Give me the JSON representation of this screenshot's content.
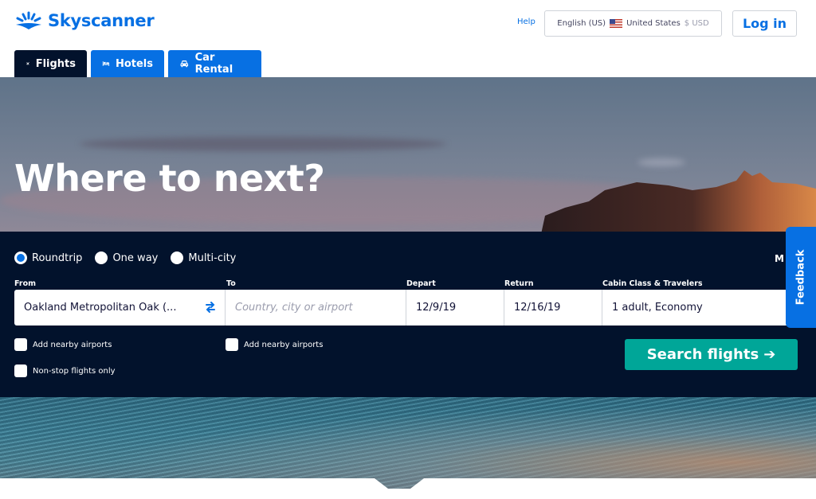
{
  "header": {
    "logo_text": "Skyscanner",
    "help_label": "Help",
    "locale": {
      "language": "English (US)",
      "country": "United States",
      "currency": "$ USD"
    },
    "login_label": "Log in"
  },
  "tabs": [
    {
      "label": "Flights",
      "icon": "plane-icon",
      "active": true
    },
    {
      "label": "Hotels",
      "icon": "bed-icon",
      "active": false
    },
    {
      "label": "Car Rental",
      "icon": "car-icon",
      "active": false
    }
  ],
  "hero": {
    "title": "Where to next?"
  },
  "search": {
    "trip_types": [
      {
        "label": "Roundtrip",
        "selected": true
      },
      {
        "label": "One way",
        "selected": false
      },
      {
        "label": "Multi-city",
        "selected": false
      }
    ],
    "more_label_partial": "M",
    "fields": {
      "from": {
        "label": "From",
        "value": "Oakland Metropolitan Oak (..."
      },
      "to": {
        "label": "To",
        "placeholder": "Country, city or airport",
        "value": ""
      },
      "depart": {
        "label": "Depart",
        "value": "12/9/19"
      },
      "return": {
        "label": "Return",
        "value": "12/16/19"
      },
      "cabin": {
        "label": "Cabin Class & Travelers",
        "value": "1 adult, Economy"
      }
    },
    "checkboxes": {
      "from_nearby": {
        "label": "Add nearby airports",
        "checked": false
      },
      "to_nearby": {
        "label": "Add nearby airports",
        "checked": false
      },
      "nonstop": {
        "label": "Non-stop flights only",
        "checked": false
      }
    },
    "submit_label": "Search flights",
    "submit_arrow": "➔"
  },
  "feedback_label": "Feedback",
  "colors": {
    "brand_blue": "#0770e3",
    "navy": "#02122c",
    "search_green": "#00a698"
  }
}
